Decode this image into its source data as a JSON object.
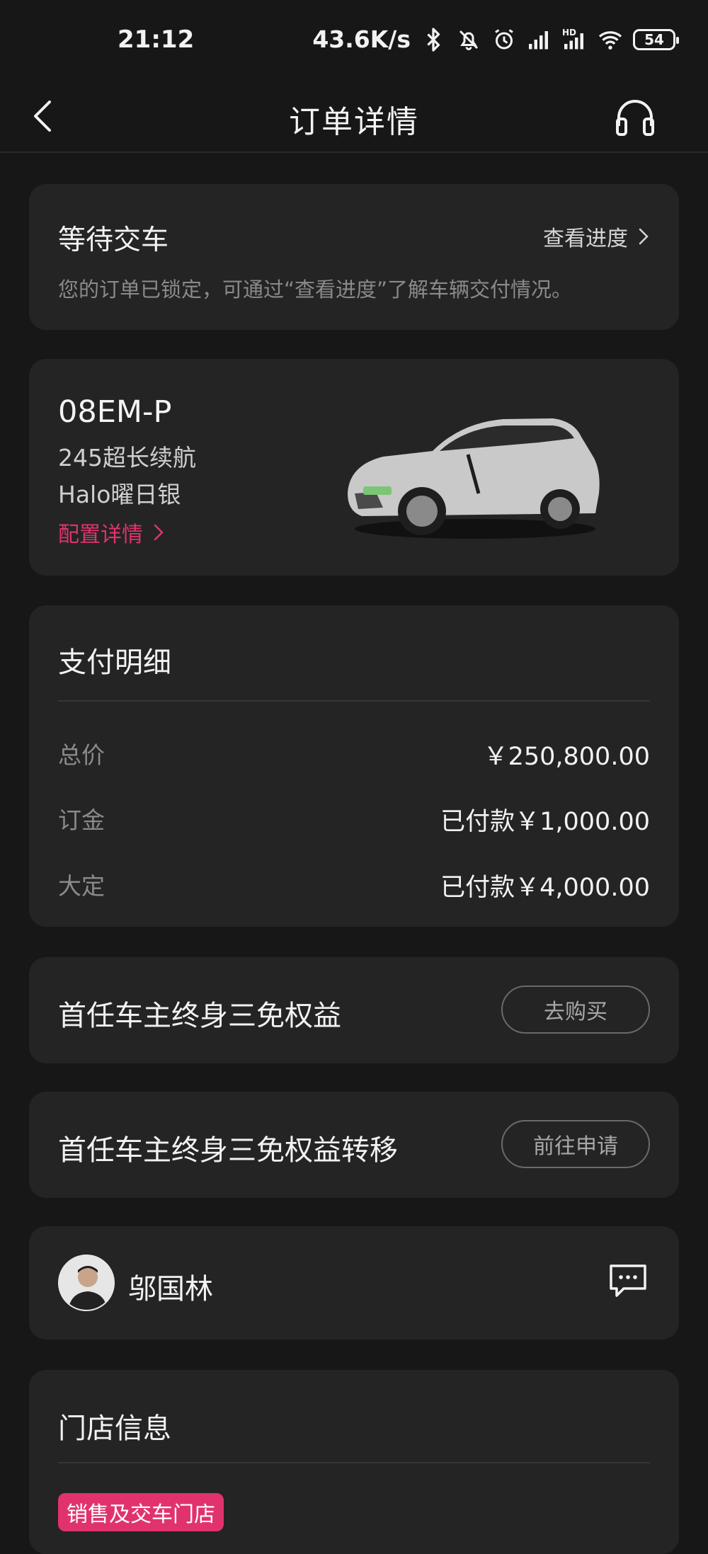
{
  "status_bar": {
    "time": "21:12",
    "speed": "43.6K/s",
    "battery": "54",
    "icons": [
      "bluetooth-icon",
      "mute-icon",
      "alarm-icon",
      "signal-icon",
      "hd-signal-icon",
      "wifi-icon"
    ]
  },
  "nav": {
    "title": "订单详情",
    "back_icon": "chevron-left-icon",
    "support_icon": "headphones-icon"
  },
  "order_status": {
    "title": "等待交车",
    "link_label": "查看进度",
    "description": "您的订单已锁定，可通过“查看进度”了解车辆交付情况。"
  },
  "vehicle": {
    "model": "08EM-P",
    "range": "245超长续航",
    "color": "Halo曜日银",
    "config_link": "配置详情"
  },
  "payment": {
    "title": "支付明细",
    "rows": [
      {
        "label": "总价",
        "value": "￥250,800.00"
      },
      {
        "label": "订金",
        "value": "已付款￥1,000.00"
      },
      {
        "label": "大定",
        "value": "已付款￥4,000.00"
      }
    ]
  },
  "benefits": [
    {
      "title": "首任车主终身三免权益",
      "button": "去购买"
    },
    {
      "title": "首任车主终身三免权益转移",
      "button": "前往申请"
    }
  ],
  "advisor": {
    "name": "邬国林",
    "chat_icon": "chat-bubble-icon"
  },
  "store": {
    "title": "门店信息",
    "badge": "销售及交车门店"
  },
  "colors": {
    "accent": "#e0336e",
    "background": "#171717",
    "card": "#242424"
  }
}
